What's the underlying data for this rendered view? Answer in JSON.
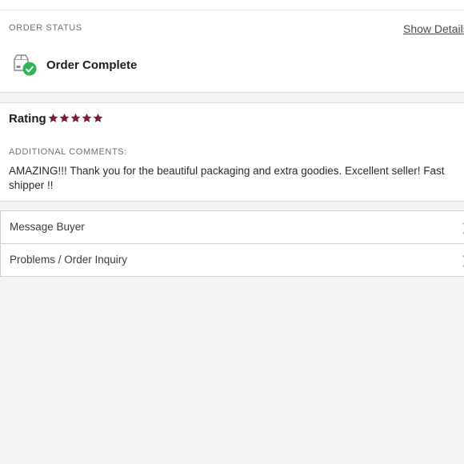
{
  "order_status": {
    "section_label": "ORDER STATUS",
    "show_details_label": "Show Details",
    "status_text": "Order Complete",
    "status_icon": "box-check-icon",
    "status_color": "#2fb552"
  },
  "rating": {
    "label": "Rating",
    "stars": 5,
    "max_stars": 5,
    "star_color": "#7a1f33",
    "comments_label": "ADDITIONAL COMMENTS:",
    "comments_text": "AMAZING!!! Thank you for the beautiful packaging and extra goodies. Excellent seller! Fast shipper !!"
  },
  "actions": {
    "message_buyer_label": "Message Buyer",
    "problems_label": "Problems / Order Inquiry",
    "chevron_icon": "chevron-right-icon"
  }
}
